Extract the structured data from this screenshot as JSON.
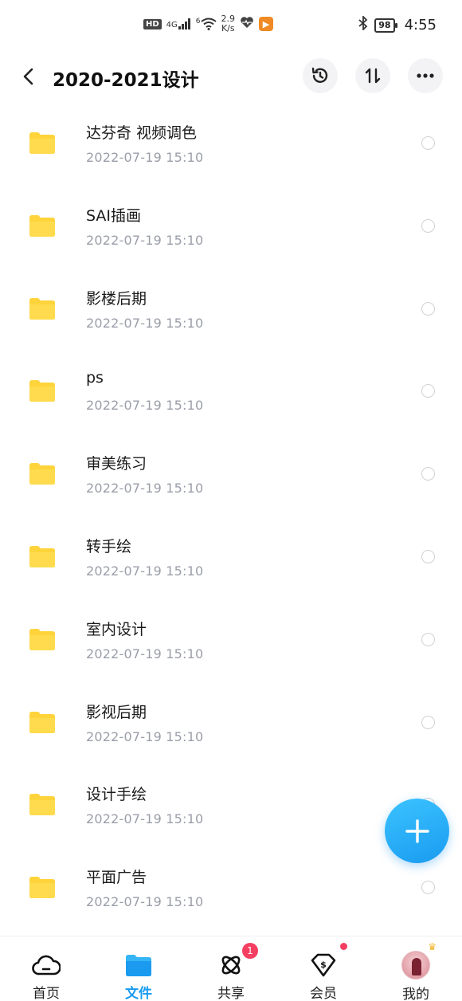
{
  "status_bar": {
    "hd_label": "HD",
    "signal_label": "4G",
    "wifi_label": "6",
    "speed_value": "2.9",
    "speed_unit": "K/s",
    "battery_level": "98",
    "time": "4:55"
  },
  "header": {
    "title": "2020-2021设计"
  },
  "folders": [
    {
      "name": "达芬奇 视频调色",
      "date": "2022-07-19  15:10"
    },
    {
      "name": "SAI插画",
      "date": "2022-07-19  15:10"
    },
    {
      "name": "影楼后期",
      "date": "2022-07-19  15:10"
    },
    {
      "name": "ps",
      "date": "2022-07-19  15:10"
    },
    {
      "name": "审美练习",
      "date": "2022-07-19  15:10"
    },
    {
      "name": "转手绘",
      "date": "2022-07-19  15:10"
    },
    {
      "name": "室内设计",
      "date": "2022-07-19  15:10"
    },
    {
      "name": "影视后期",
      "date": "2022-07-19  15:10"
    },
    {
      "name": "设计手绘",
      "date": "2022-07-19  15:10"
    },
    {
      "name": "平面广告",
      "date": "2022-07-19  15:10"
    }
  ],
  "bottom_nav": {
    "items": [
      {
        "label": "首页",
        "icon": "cloud-icon"
      },
      {
        "label": "文件",
        "icon": "folder-icon",
        "active": true
      },
      {
        "label": "共享",
        "icon": "share-icon",
        "badge": "1"
      },
      {
        "label": "会员",
        "icon": "vip-icon",
        "dot": true
      },
      {
        "label": "我的",
        "icon": "avatar"
      }
    ]
  },
  "colors": {
    "accent": "#1a9bf0",
    "folder": "#ffd43b",
    "badge": "#f43f62",
    "date_text": "#9a9ea8"
  }
}
